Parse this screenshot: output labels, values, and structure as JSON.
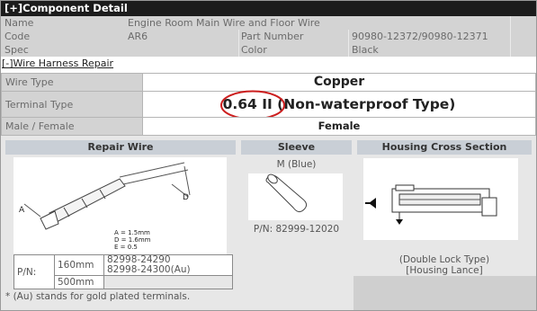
{
  "title": "[+]Component Detail",
  "info": {
    "name_label": "Name",
    "name_value": "Engine Room Main Wire and Floor Wire",
    "code_label": "Code",
    "code_value": "AR6",
    "part_number_label": "Part Number",
    "part_number_value": "90980-12372/90980-12371",
    "spec_label": "Spec",
    "spec_value": "",
    "color_label": "Color",
    "color_value": "Black"
  },
  "repair_link": "[-]Wire Harness Repair",
  "specs": {
    "wire_type_label": "Wire Type",
    "wire_type_value": "Copper",
    "terminal_type_label": "Terminal Type",
    "terminal_type_value": "0.64 II (Non-waterproof Type)",
    "male_female_label": "Male / Female",
    "male_female_value": "Female"
  },
  "repair_wire": {
    "header": "Repair Wire",
    "dim_a": "A = 1.5mm",
    "dim_d": "D = 1.6mm",
    "dim_e": "E = 0.5",
    "label_a": "A",
    "label_d": "D",
    "pn_label": "P/N:",
    "rows": [
      {
        "length": "160mm",
        "parts": [
          "82998-24290",
          "82998-24300(Au)"
        ]
      },
      {
        "length": "500mm",
        "parts": []
      }
    ],
    "footnote": "* (Au) stands for gold plated terminals."
  },
  "sleeve": {
    "header": "Sleeve",
    "color": "M (Blue)",
    "pn": "P/N: 82999-12020"
  },
  "housing": {
    "header": "Housing Cross Section",
    "caption_line1": "(Double Lock Type)",
    "caption_line2": "[Housing Lance]"
  },
  "colors": {
    "topbar": "#1c1c1c",
    "highlight_circle": "#cc1e1e"
  }
}
